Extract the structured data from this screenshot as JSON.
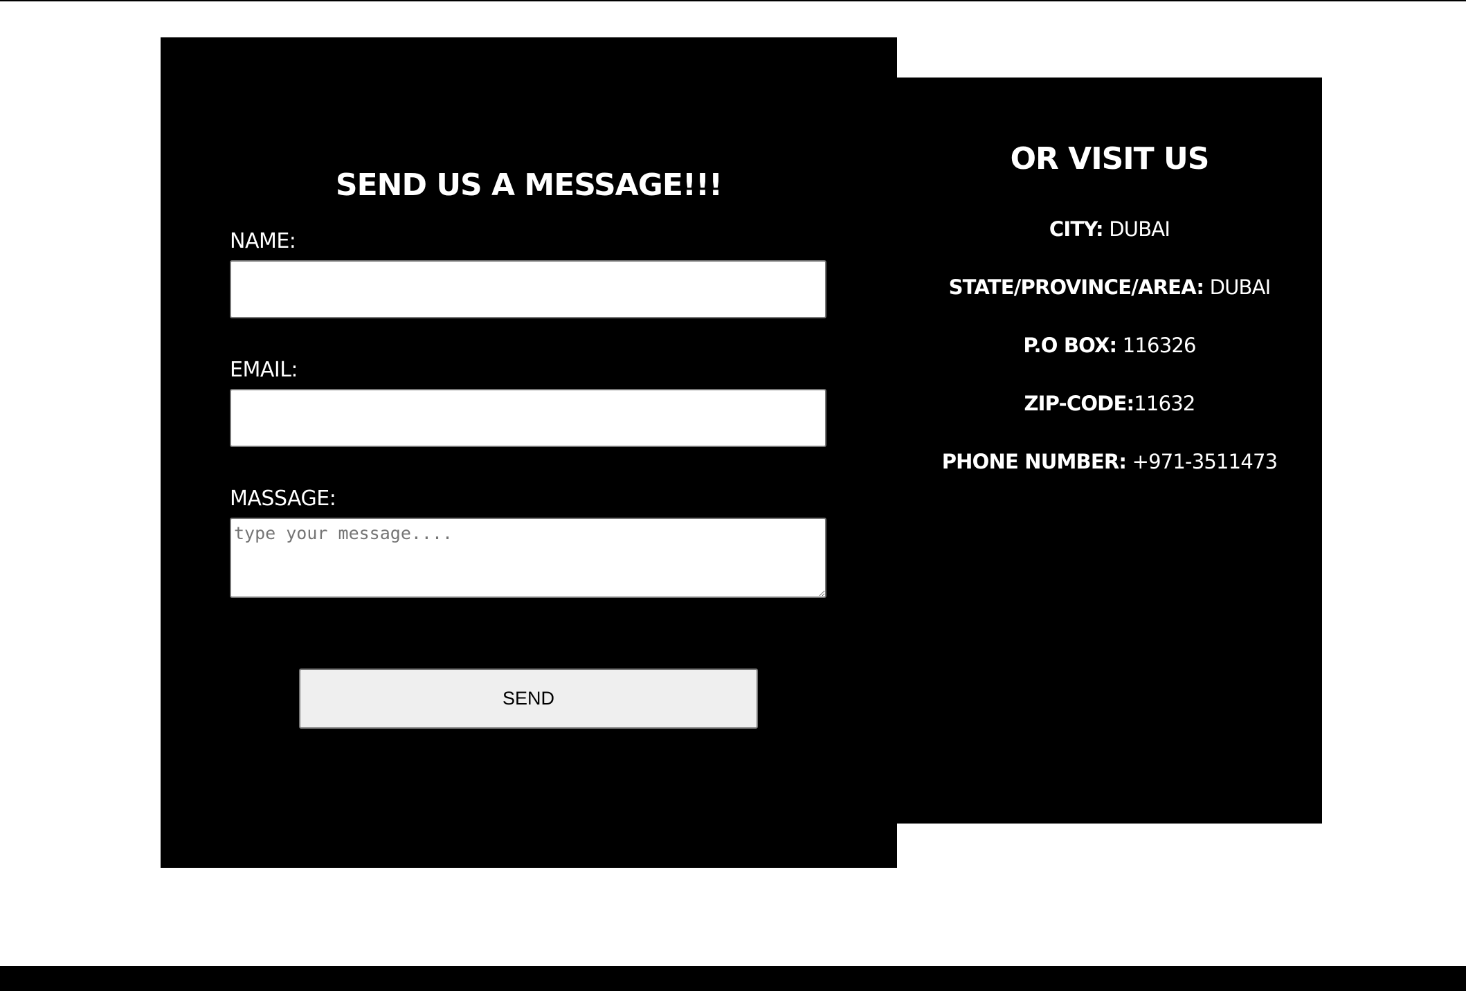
{
  "form": {
    "title": "SEND US A MESSAGE!!!",
    "name_label": "NAME:",
    "name_value": "",
    "email_label": "EMAIL:",
    "email_value": "",
    "message_label": "MASSAGE:",
    "message_placeholder": "type your message....",
    "send_label": "SEND"
  },
  "visit": {
    "title": "OR VISIT US",
    "items": [
      {
        "key": "CITY:",
        "value": " DUBAI"
      },
      {
        "key": "STATE/PROVINCE/AREA:",
        "value": " DUBAI"
      },
      {
        "key": "P.O BOX:",
        "value": " 116326"
      },
      {
        "key": "ZIP-CODE:",
        "value": "11632"
      },
      {
        "key": "PHONE NUMBER:",
        "value": " +971-3511473"
      }
    ]
  },
  "colors": {
    "panel": "#000000",
    "text": "#ffffff",
    "button": "#efefef"
  }
}
